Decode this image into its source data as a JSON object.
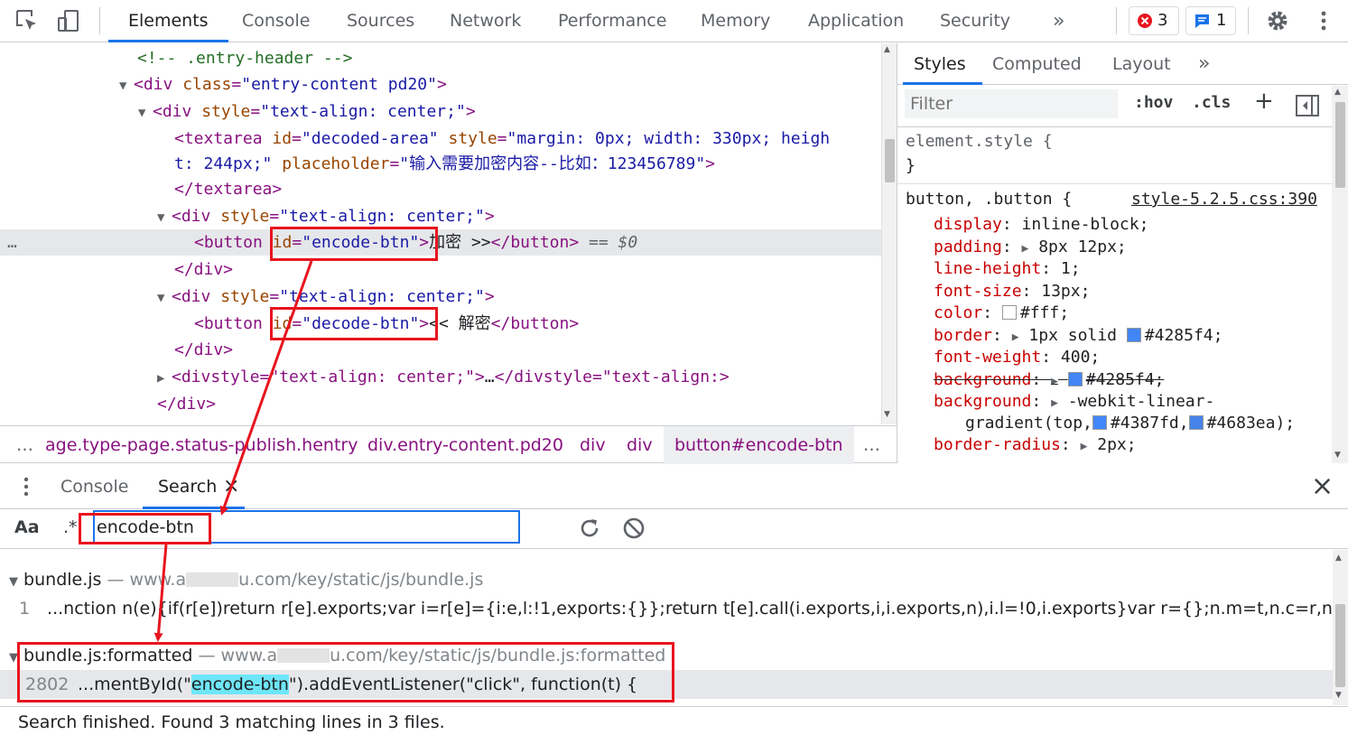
{
  "toolbar": {
    "tabs": [
      "Elements",
      "Console",
      "Sources",
      "Network",
      "Performance",
      "Memory",
      "Application",
      "Security"
    ],
    "more": "»",
    "errors_count": "3",
    "messages_count": "1"
  },
  "elements": {
    "comment": "<!-- .entry-header -->",
    "l2_tag_open": "<div",
    "l2_attr": "class",
    "l2_val": "\"entry-content pd20\"",
    "l3_attr": "style",
    "l3_val": "\"text-align: center;\"",
    "ta_open": "<textarea",
    "ta_id_attr": "id",
    "ta_id_val": "\"decoded-area\"",
    "ta_style_attr": "style",
    "ta_style_val1": "\"margin: 0px; width: 330px; heigh",
    "ta_style_val2": "t: 244px;\"",
    "ta_ph_attr": "placeholder",
    "ta_ph_val": "\"输入需要加密内容--比如：123456789\"",
    "ta_close": "</textarea>",
    "div_style_attr": "style",
    "div_style_val": "\"text-align: center;\"",
    "btn_open": "<button",
    "btn1_id": "id",
    "btn1_id_val": "\"encode-btn\"",
    "btn1_text": "加密 >>",
    "btn_close": "</button>",
    "sel_marker": "== $0",
    "div_close": "</div>",
    "btn2_id": "id",
    "btn2_id_val": "\"decode-btn\"",
    "btn2_text": "<< 解密",
    "collapsed_open": "<divstyle=\"text-align: center;\">",
    "collapsed_ellipsis": "…",
    "collapsed_close": "</divstyle=\"text-align:>",
    "last_close": "</div>",
    "row_dots": "…"
  },
  "breadcrumb": [
    "…",
    "age.type-page.status-publish.hentry",
    "div.entry-content.pd20",
    "div",
    "div",
    "button#encode-btn",
    "…"
  ],
  "styles": {
    "tabs": [
      "Styles",
      "Computed",
      "Layout"
    ],
    "more": "»",
    "filter_placeholder": "Filter",
    "hov": ":hov",
    "cls": ".cls",
    "plus": "+",
    "element_style": "element.style {",
    "close_brace": "}",
    "rule_selector": "button, .button {",
    "rule_source": "style-5.2.5.css:390",
    "props": [
      {
        "name": "display",
        "value": "inline-block;"
      },
      {
        "name": "padding",
        "value": "8px 12px;"
      },
      {
        "name": "line-height",
        "value": "1;"
      },
      {
        "name": "font-size",
        "value": "13px;"
      },
      {
        "name": "color",
        "value": "#fff;"
      },
      {
        "name": "border",
        "value": "1px solid",
        "value2": "#4285f4;"
      },
      {
        "name": "font-weight",
        "value": "400;"
      },
      {
        "name": "background",
        "value": "#4285f4;"
      },
      {
        "name": "background",
        "value": "-webkit-linear-"
      },
      {
        "name": "border-radius",
        "value": "2px;"
      }
    ],
    "gradient_line": "gradient(top,",
    "gradient_c1": "#4387fd,",
    "gradient_c2": "#4683ea);",
    "colors": {
      "white": "#ffffff",
      "blue": "#4285f4",
      "c1": "#4387fd",
      "c2": "#4683ea"
    }
  },
  "drawer": {
    "tabs": [
      "Console",
      "Search"
    ],
    "close": "×",
    "aa": "Aa",
    "regex": ".*",
    "query": "encode-btn"
  },
  "results": {
    "file1_name": "bundle.js",
    "file1_dash": "—",
    "file1_url_a": "www.a",
    "file1_url_b": "u.com/key/static/js/bundle.js",
    "r1_line": "1",
    "r1_text": "...nction n(e){if(r[e])return r[e].exports;var i=r[e]={i:e,l:!1,exports:{}};return t[e].call(i.exports,i,i.exports,n),i.l=!0,i.exports}var r={};n.m=t,n.c=r,n.d=function(t,r...",
    "file2_name": "bundle.js:formatted",
    "file2_dash": "—",
    "file2_url_a": "www.a",
    "file2_url_b": "u.com/key/static/js/bundle.js:formatted",
    "r2_line": "2802",
    "r2_pre": "...mentById(\"",
    "r2_match": "encode-btn",
    "r2_post": "\").addEventListener(\"click\", function(t) {"
  },
  "status": "Search finished.  Found 3 matching lines in 3 files."
}
